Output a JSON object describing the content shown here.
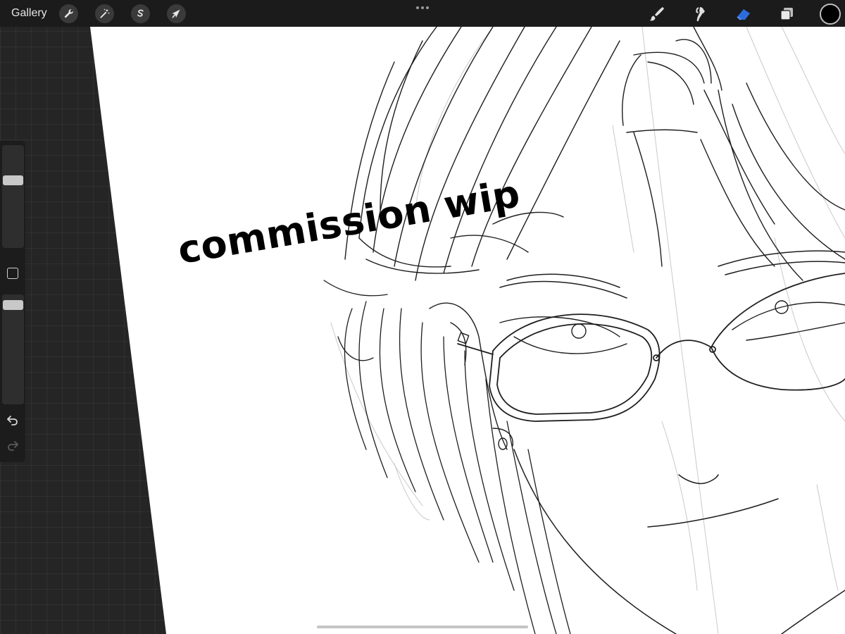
{
  "toolbar": {
    "gallery_label": "Gallery",
    "left_tools": [
      {
        "icon": "wrench-icon",
        "name": "actions"
      },
      {
        "icon": "magic-wand-icon",
        "name": "adjustments"
      },
      {
        "icon": "selection-s-icon",
        "name": "selection"
      },
      {
        "icon": "arrow-cursor-icon",
        "name": "transform"
      }
    ],
    "more_icon": "ellipsis-icon",
    "right_tools": [
      {
        "icon": "brush-icon",
        "name": "paint"
      },
      {
        "icon": "smudge-icon",
        "name": "smudge"
      },
      {
        "icon": "eraser-icon",
        "name": "erase",
        "active": true
      },
      {
        "icon": "layers-icon",
        "name": "layers"
      }
    ],
    "current_color": "#000000",
    "active_color": "#2d6cdf"
  },
  "sidebar": {
    "brush_size_icon": "size-slider",
    "opacity_icon": "opacity-slider",
    "modify_icon": "square-icon",
    "undo_icon": "undo-icon",
    "redo_icon": "redo-icon"
  },
  "canvas": {
    "watermark_text": "commission wip",
    "paper_color": "#ffffff"
  }
}
